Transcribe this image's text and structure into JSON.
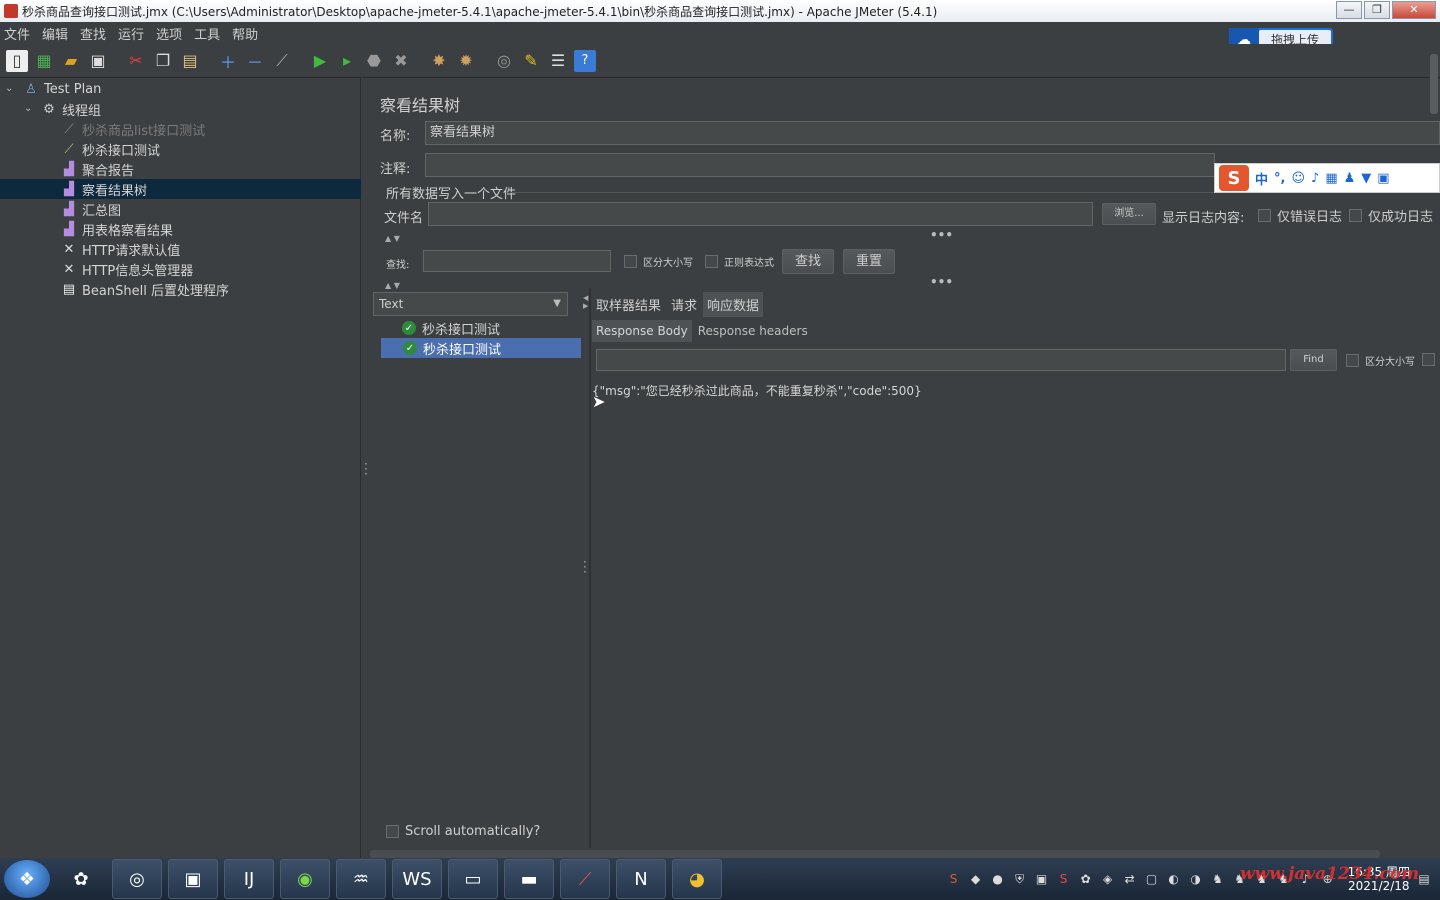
{
  "window": {
    "title": "秒杀商品查询接口测试.jmx (C:\\Users\\Administrator\\Desktop\\apache-jmeter-5.4.1\\apache-jmeter-5.4.1\\bin\\秒杀商品查询接口测试.jmx) - Apache JMeter (5.4.1)",
    "min": "—",
    "max": "❐",
    "close": "✕"
  },
  "menu": [
    "文件",
    "编辑",
    "查找",
    "运行",
    "选项",
    "工具",
    "帮助"
  ],
  "upload": {
    "label": "拖拽上传"
  },
  "tree": {
    "items": [
      {
        "label": "Test Plan",
        "icon": "test-plan-icon"
      },
      {
        "label": "线程组",
        "icon": "gear-icon"
      },
      {
        "label": "秒杀商品list接口测试",
        "icon": "sampler-icon"
      },
      {
        "label": "秒杀接口测试",
        "icon": "sampler-icon"
      },
      {
        "label": "聚合报告",
        "icon": "chart-icon"
      },
      {
        "label": "察看结果树",
        "icon": "chart-icon"
      },
      {
        "label": "汇总图",
        "icon": "chart-icon"
      },
      {
        "label": "用表格察看结果",
        "icon": "chart-icon"
      },
      {
        "label": "HTTP请求默认值",
        "icon": "wrench-icon"
      },
      {
        "label": "HTTP信息头管理器",
        "icon": "wrench-icon"
      },
      {
        "label": "BeanShell 后置处理程序",
        "icon": "script-icon"
      }
    ]
  },
  "panel": {
    "title": "察看结果树",
    "name_label": "名称:",
    "name_value": "察看结果树",
    "comment_label": "注释:",
    "comment_value": "",
    "file_section": "所有数据写入一个文件",
    "filename_label": "文件名",
    "filename_value": "",
    "browse_btn": "浏览...",
    "log_label": "显示日志内容:",
    "error_log": "仅错误日志",
    "success_log": "仅成功日志",
    "search_label": "查找:",
    "search_value": "",
    "case_sensitive": "区分大小写",
    "regex": "正则表达式",
    "find_btn": "查找",
    "reset_btn": "重置"
  },
  "results": {
    "renderer": "Text",
    "rows": [
      "秒杀接口测试",
      "秒杀接口测试"
    ],
    "tabs": [
      "取样器结果",
      "请求",
      "响应数据"
    ],
    "subtabs": [
      "Response Body",
      "Response headers"
    ],
    "find_btn": "Find",
    "find_case": "区分大小写",
    "body": "{\"msg\":\"您已经秒杀过此商品，不能重复秒杀\",\"code\":500}",
    "scroll_auto": "Scroll automatically?"
  },
  "ime": {
    "mode": "中"
  },
  "taskbar": {
    "time": "16:35 周四",
    "date": "2021/2/18",
    "watermark": "www.java1234.com"
  }
}
